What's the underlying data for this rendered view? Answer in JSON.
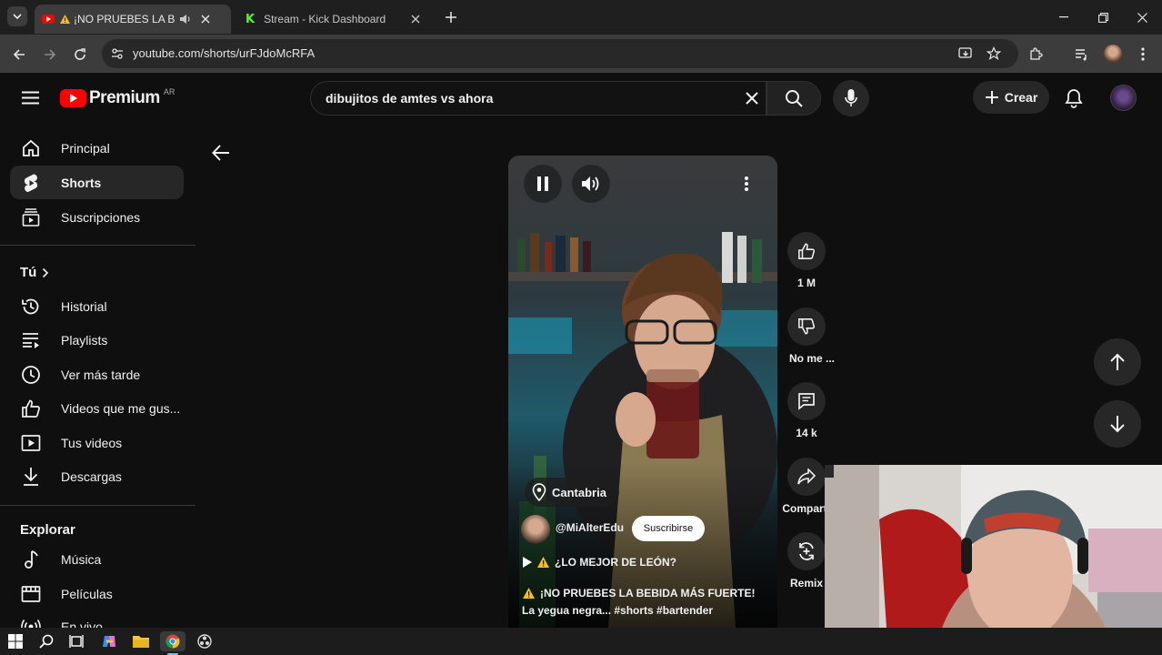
{
  "browser": {
    "tabs": [
      {
        "title": "¡NO PRUEBES LA BEBIDA",
        "active": true
      },
      {
        "title": "Stream - Kick Dashboard",
        "active": false
      }
    ],
    "url": "youtube.com/shorts/urFJdoMcRFA"
  },
  "header": {
    "logo_text": "Premium",
    "region": "AR",
    "search_value": "dibujitos de amtes vs ahora",
    "create_label": "Crear"
  },
  "sidebar": {
    "main": [
      {
        "label": "Principal",
        "icon": "home-icon"
      },
      {
        "label": "Shorts",
        "icon": "shorts-icon",
        "active": true
      },
      {
        "label": "Suscripciones",
        "icon": "subscriptions-icon"
      }
    ],
    "you_heading": "Tú",
    "you": [
      {
        "label": "Historial",
        "icon": "history-icon"
      },
      {
        "label": "Playlists",
        "icon": "playlists-icon"
      },
      {
        "label": "Ver más tarde",
        "icon": "watch-later-icon"
      },
      {
        "label": "Videos que me gus...",
        "icon": "liked-icon"
      },
      {
        "label": "Tus videos",
        "icon": "your-videos-icon"
      },
      {
        "label": "Descargas",
        "icon": "downloads-icon"
      }
    ],
    "explore_heading": "Explorar",
    "explore": [
      {
        "label": "Música",
        "icon": "music-icon"
      },
      {
        "label": "Películas",
        "icon": "movies-icon"
      },
      {
        "label": "En vivo",
        "icon": "live-icon"
      }
    ]
  },
  "short": {
    "location": "Cantabria",
    "channel": "@MiAlterEdu",
    "subscribe_label": "Suscribirse",
    "playlist_line": "¿LO MEJOR DE LEÓN?",
    "title_line": "¡NO PRUEBES LA BEBIDA MÁS FUERTE!",
    "desc_line": "La yegua negra... #shorts #bartender"
  },
  "actions": {
    "likes": "1 M",
    "dislike": "No me ...",
    "comments": "14 k",
    "share": "Compart",
    "remix": "Remix"
  },
  "colors": {
    "background": "#0f0f0f",
    "youtube_red": "#ff0000",
    "kick_green": "#53fc18",
    "chip": "#272727"
  }
}
